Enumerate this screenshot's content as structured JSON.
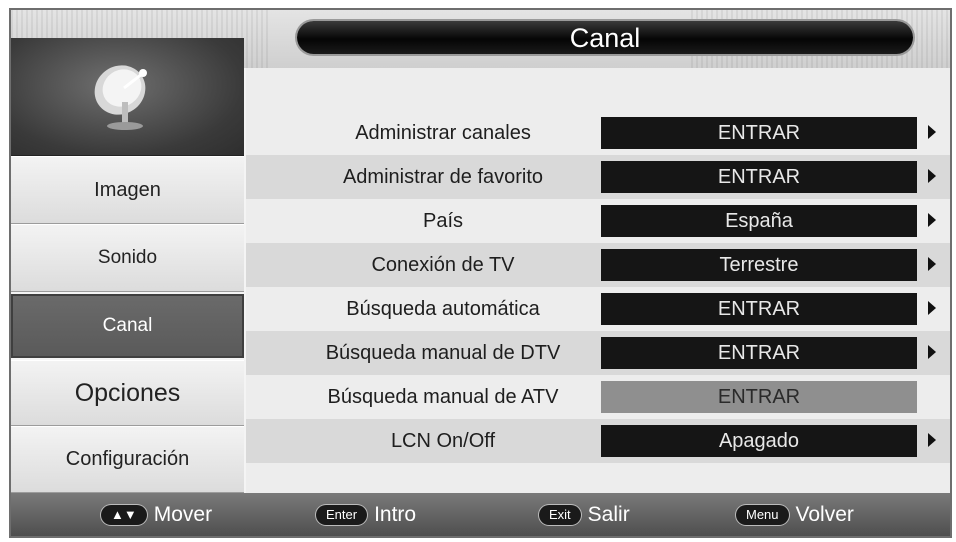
{
  "menu": {
    "title": "Canal"
  },
  "sidebar": {
    "icon": "satellite-dish-icon",
    "items": [
      {
        "label": "Imagen"
      },
      {
        "label": "Sonido"
      },
      {
        "label": "Canal",
        "active": true
      },
      {
        "label": "Opciones"
      },
      {
        "label": "Configuración"
      }
    ]
  },
  "rows": [
    {
      "label": "Administrar canales",
      "value": "ENTRAR",
      "arrow": true
    },
    {
      "label": "Administrar de favorito",
      "value": "ENTRAR",
      "arrow": true
    },
    {
      "label": "País",
      "value": "España",
      "arrow": true
    },
    {
      "label": "Conexión de TV",
      "value": "Terrestre",
      "arrow": true
    },
    {
      "label": "Búsqueda automática",
      "value": "ENTRAR",
      "arrow": true
    },
    {
      "label": "Búsqueda manual de DTV",
      "value": "ENTRAR",
      "arrow": true
    },
    {
      "label": "Búsqueda manual de ATV",
      "value": "ENTRAR",
      "arrow": false,
      "disabled": true
    },
    {
      "label": "LCN On/Off",
      "value": "Apagado",
      "arrow": true
    }
  ],
  "footer": {
    "hints": [
      {
        "key": "▲▼",
        "label": "Mover"
      },
      {
        "key": "Enter",
        "label": "Intro"
      },
      {
        "key": "Exit",
        "label": "Salir"
      },
      {
        "key": "Menu",
        "label": "Volver"
      }
    ]
  },
  "colors": {
    "value_bg": "#151515",
    "active_bg": "#636363",
    "disabled_bg": "#8f8f8f"
  }
}
